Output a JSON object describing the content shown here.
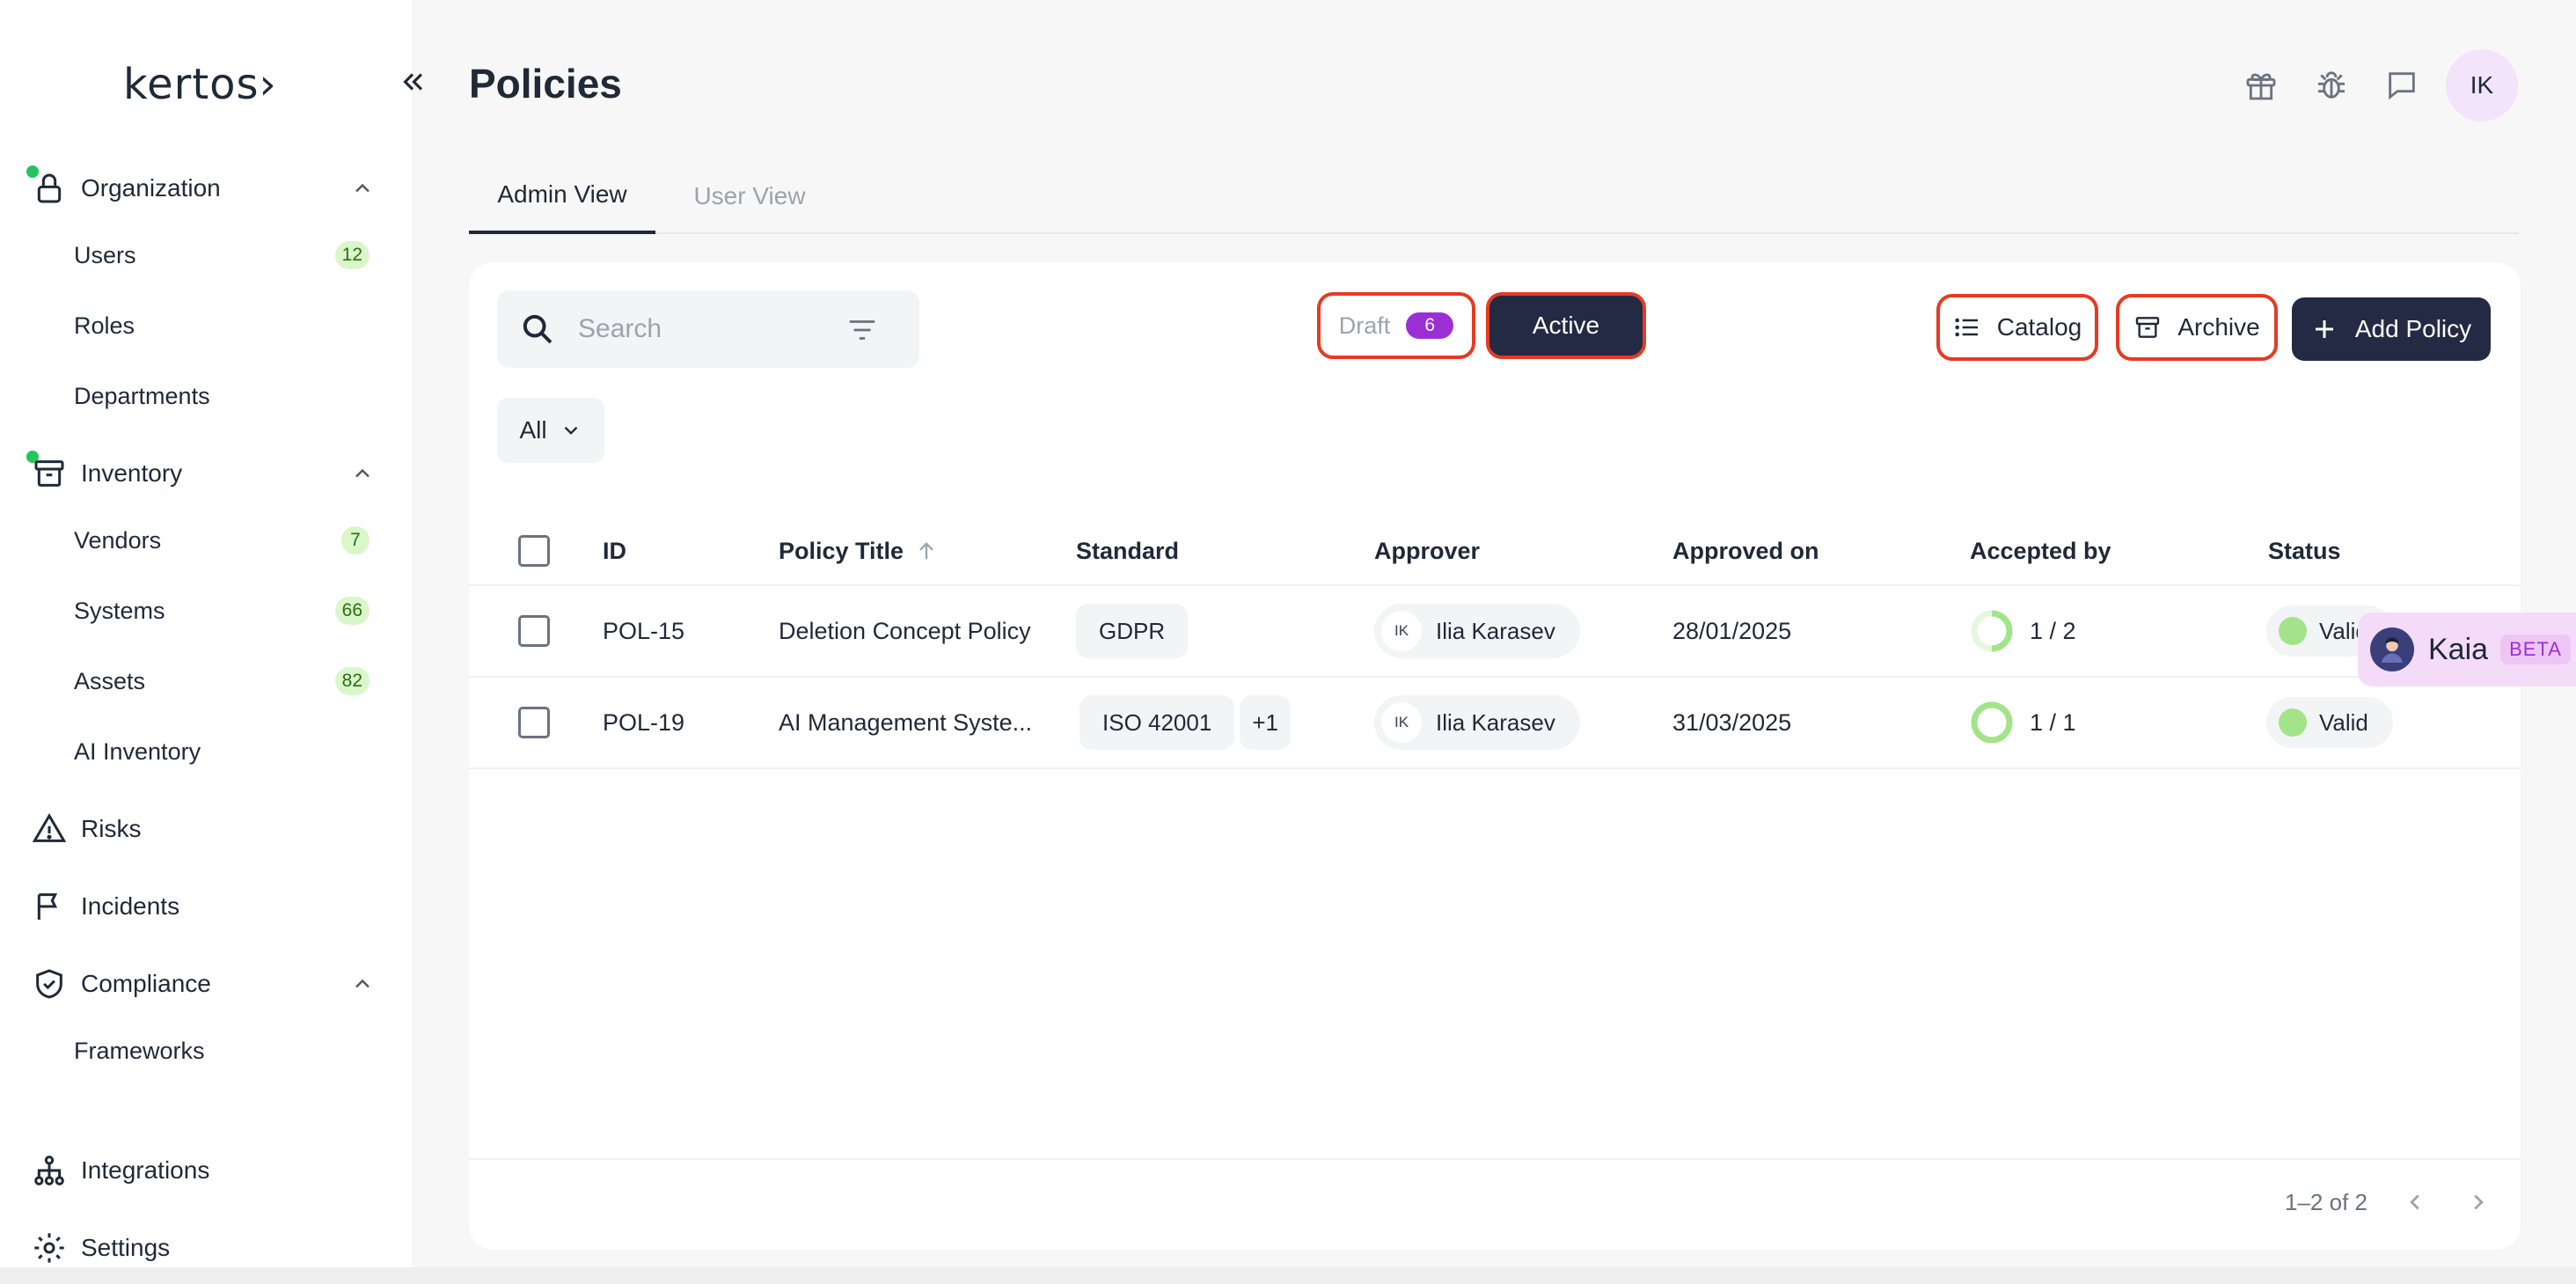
{
  "app": {
    "logo": "kertos›",
    "page_title": "Policies"
  },
  "sidebar": {
    "sections": [
      {
        "key": "organization",
        "label": "Organization",
        "icon": "lock-icon",
        "has_dot": true,
        "items": [
          {
            "label": "Users",
            "count": "12"
          },
          {
            "label": "Roles",
            "count": ""
          },
          {
            "label": "Departments",
            "count": ""
          }
        ]
      },
      {
        "key": "inventory",
        "label": "Inventory",
        "icon": "archive-box-icon",
        "has_dot": true,
        "items": [
          {
            "label": "Vendors",
            "count": "7"
          },
          {
            "label": "Systems",
            "count": "66"
          },
          {
            "label": "Assets",
            "count": "82"
          },
          {
            "label": "AI Inventory",
            "count": ""
          }
        ]
      },
      {
        "key": "risks",
        "label": "Risks",
        "icon": "warning-triangle-icon"
      },
      {
        "key": "incidents",
        "label": "Incidents",
        "icon": "flag-icon"
      },
      {
        "key": "compliance",
        "label": "Compliance",
        "icon": "shield-check-icon",
        "items": [
          {
            "label": "Frameworks",
            "count": ""
          }
        ]
      },
      {
        "key": "integrations",
        "label": "Integrations",
        "icon": "network-icon"
      },
      {
        "key": "settings",
        "label": "Settings",
        "icon": "gear-icon"
      }
    ]
  },
  "header": {
    "avatar_initials": "IK"
  },
  "tabs": [
    {
      "label": "Admin View",
      "active": true
    },
    {
      "label": "User View",
      "active": false
    }
  ],
  "toolbar": {
    "search_placeholder": "Search",
    "draft_label": "Draft",
    "draft_count": "6",
    "active_label": "Active",
    "catalog_label": "Catalog",
    "archive_label": "Archive",
    "add_label": "Add Policy",
    "filter_label": "All"
  },
  "table": {
    "columns": [
      "ID",
      "Policy Title",
      "Standard",
      "Approver",
      "Approved on",
      "Accepted by",
      "Status"
    ],
    "rows": [
      {
        "id": "POL-15",
        "title": "Deletion Concept Policy",
        "standard": "GDPR",
        "standard_extra": "",
        "approver_initials": "IK",
        "approver": "Ilia Karasev",
        "approved_on": "28/01/2025",
        "accepted": "1 / 2",
        "accepted_fraction": 0.5,
        "status": "Valid"
      },
      {
        "id": "POL-19",
        "title": "AI Management Syste...",
        "standard": "ISO 42001",
        "standard_extra": "+1",
        "approver_initials": "IK",
        "approver": "Ilia Karasev",
        "approved_on": "31/03/2025",
        "accepted": "1 / 1",
        "accepted_fraction": 1.0,
        "status": "Valid"
      }
    ]
  },
  "pager": {
    "text": "1–2 of 2"
  },
  "kaia": {
    "name": "Kaia",
    "badge": "BETA"
  },
  "colors": {
    "primary": "#222a44",
    "highlight": "#e53b22",
    "draft_badge": "#9b2fd6",
    "count_badge_bg": "#d9f7c8",
    "status_valid": "#a3e38a"
  }
}
